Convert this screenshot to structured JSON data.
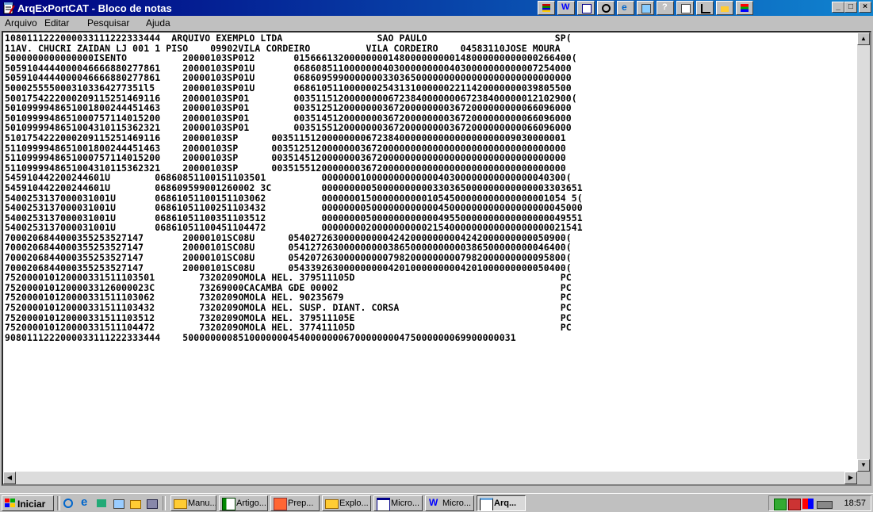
{
  "window": {
    "title": "ArqExPortCAT - Bloco de notas",
    "buttons": {
      "minimize": "_",
      "maximize": "□",
      "close": "×"
    }
  },
  "menu": [
    "Arquivo",
    "Editar",
    "Pesquisar",
    "Ajuda"
  ],
  "content": {
    "lines": [
      "1080111222000033111222333444  ARQUIVO EXEMPLO LTDA                 SAO PAULO                       SP(",
      "11AV. CHUCRI ZAIDAN LJ 001 1 PISO    09902VILA CORDEIRO          VILA CORDEIRO    04583110JOSE MOURA",
      "5000000000000000ISENTO          20000103SP012       01566613200000000148000000000148000000000000266400(",
      "5059104444000046666880277861    20000103SP01U       06860851100000004030000000004030000000000007254000",
      "5059104444000046666880277861    20000103SP01U       06860959900000003303650000000000000000000000000000",
      "5000255550003103364277351l5     20000103SP01U       06861051100000025431310000002211420000000039805500",
      "5001754222000209115251469116    20000103SP01        00351151200000000672384000000067238400000012102900(",
      "5010999948651001800244451463    20000103SP01        00351251200000003672000000003672000000000066096000",
      "5010999948651000757114015200    20000103SP01        00351451200000003672000000003672000000000066096000",
      "5010999948651004310115362321    20000103SP01        00351551200000003672000000003672000000000066096000",
      "5101754222000209115251469116    20000103SP      00351151200000000672384000000000000000000009030000001",
      "5110999948651001800244451463    20000103SP      00351251200000003672000000000000000000000000000000000",
      "5110999948651000757114015200    20000103SP      00351451200000003672000000000000000000000000000000000",
      "5110999948651004310115362321    20000103SP      00351551200000003672000000000000000000000000000000000",
      "545910442200244601U        06860851100151103501          00000001000000000000040300000000000000040300(",
      "545910442200244601U        068609599001260002 3C         00000000050000000000330365000000000000003303651",
      "5400253137000031001U       06861051100151103062          00000001500000000001054500000000000000001054 5(",
      "5400253137000031001U       06861051100251103432          00000000500000000000045000000000000000000045000",
      "5400253137000031001U       06861051100351103512          00000000500000000000049550000000000000000049551",
      "5400253137000031001U       06861051100451104472          00000000200000000002154000000000000000000021541",
      "7000206844000355253527147       20000101SC08U      05402726300000000042420000000004242000000000050900(",
      "7000206844000355253527147       20000101SC08U      05412726300000000038650000000000386500000000046400(",
      "7000206844000355253527147       20000101SC08U      05420726300000000079820000000007982000000000095800(",
      "7000206844000355253527147       20000101SC08U      05433926300000000042010000000004201000000000050400(",
      "752000010120000331511103501        7320209OMOLA HEL. 379511105D                                     PC",
      "75200001012000033126000023C        73269000CACAMBA GDE 00002                                        PC",
      "752000010120000331511103062        7320209OMOLA HEL. 90235679                                       PC",
      "752000010120000331511103432        7320209OMOLA HEL. SUSP. DIANT. CORSA                             PC",
      "752000010120000331511103512        7320209OMOLA HEL. 379511105E                                     PC",
      "752000010120000331511104472        7320209OMOLA HEL. 377411105D                                     PC",
      "9080111222000033111222333444    500000000851000000045400000006700000000475000000069900000031"
    ]
  },
  "taskbar": {
    "start": "Iniciar",
    "tasks": [
      "Manu...",
      "Artigo...",
      "Prep...",
      "Explo...",
      "Micro...",
      "Micro...",
      "Arq..."
    ],
    "clock": "18:57"
  },
  "colors": {
    "title_start": "#000080",
    "title_end": "#1084d0",
    "face": "#c0c0c0"
  }
}
